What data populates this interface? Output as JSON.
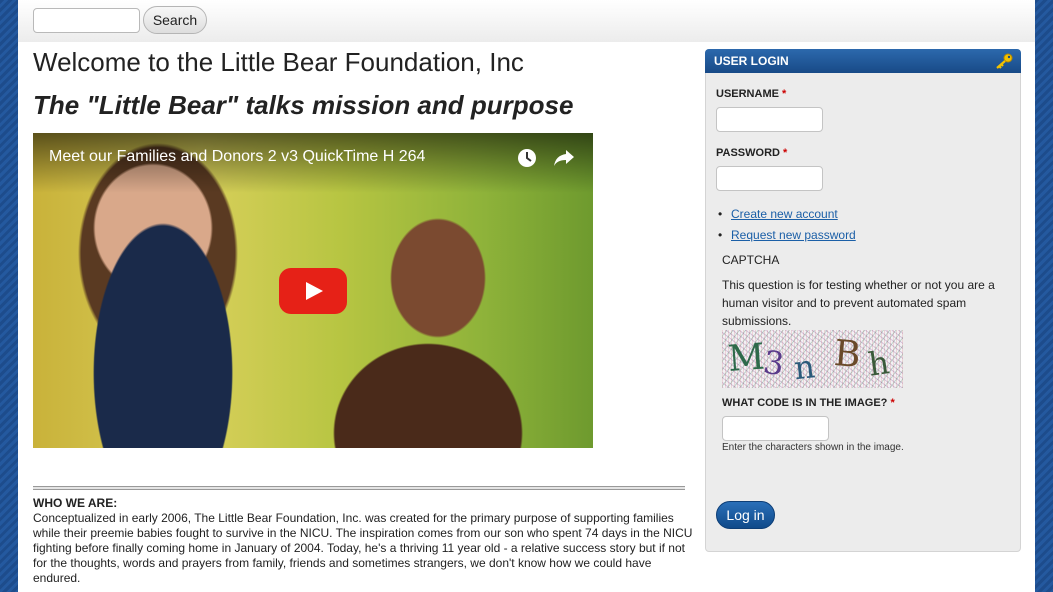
{
  "search": {
    "value": "",
    "button_label": "Search"
  },
  "main": {
    "title": "Welcome to the Little Bear Foundation, Inc",
    "subtitle": "The \"Little Bear\" talks mission and purpose",
    "video": {
      "title": "Meet our Families and Donors 2 v3 QuickTime H 264",
      "play_icon": "play-icon",
      "watch_later_icon": "clock-icon",
      "share_icon": "share-arrow-icon"
    },
    "who_heading": "WHO WE ARE:",
    "who_body": "Conceptualized in early 2006, The Little Bear Foundation, Inc. was created for the primary purpose of supporting families while their preemie babies fought to survive in the NICU. The inspiration comes from our son who spent 74 days in the NICU fighting before finally coming home in January of 2004. Today, he's a thriving 11 year old - a relative success story but if not for the thoughts, words and prayers from family, friends and sometimes strangers, we don't know how we could have endured."
  },
  "login": {
    "header": "USER LOGIN",
    "header_icon": "key-icon",
    "username_label": "USERNAME",
    "password_label": "PASSWORD",
    "required_marker": "*",
    "username_value": "",
    "password_value": "",
    "links": [
      {
        "label": "Create new account"
      },
      {
        "label": "Request new password"
      }
    ],
    "captcha_title": "CAPTCHA",
    "captcha_desc": "This question is for testing whether or not you are a human visitor and to prevent automated spam submissions.",
    "captcha_image_text": "M3nBh",
    "captcha_question": "WHAT CODE IS IN THE IMAGE?",
    "captcha_value": "",
    "captcha_hint": "Enter the characters shown in the image.",
    "submit_label": "Log in"
  },
  "colors": {
    "brand_blue": "#184a87",
    "link_blue": "#1b5fa7",
    "required_red": "#cc0000",
    "play_red": "#e62117"
  }
}
